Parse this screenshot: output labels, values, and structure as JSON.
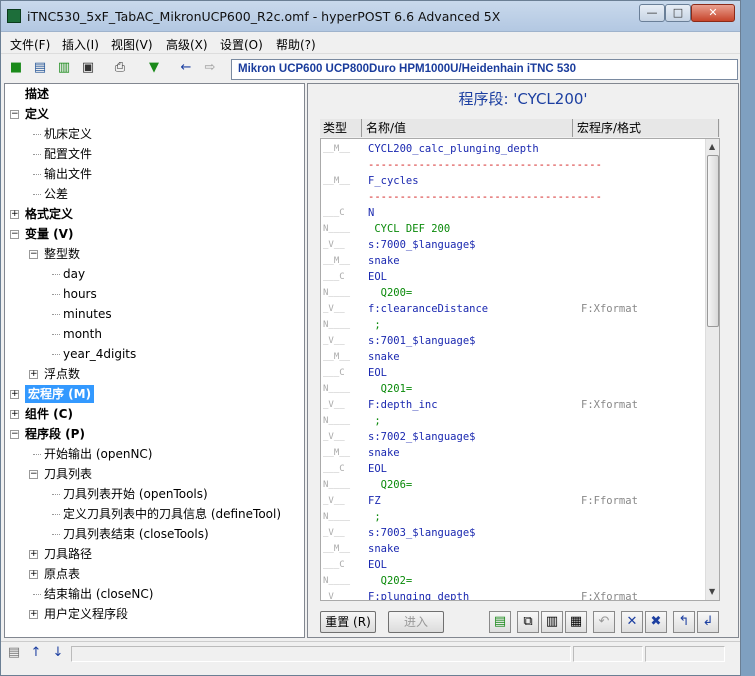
{
  "window": {
    "title": "iTNC530_5xF_TabAC_MikronUCP600_R2c.omf - hyperPOST 6.6 Advanced 5X"
  },
  "menu": [
    "文件(F)",
    "插入(I)",
    "视图(V)",
    "高级(X)",
    "设置(O)",
    "帮助(?)"
  ],
  "toolbar": {
    "postprocessor": "Mikron UCP600 UCP800Duro HPM1000U/Heidenhain iTNC 530"
  },
  "tree": {
    "items": [
      {
        "label": "描述",
        "bold": true,
        "level": 0,
        "toggle": ""
      },
      {
        "label": "定义",
        "bold": true,
        "level": 0,
        "toggle": "-"
      },
      {
        "label": "机床定义",
        "level": 1,
        "toggle": ""
      },
      {
        "label": "配置文件",
        "level": 1,
        "toggle": ""
      },
      {
        "label": "输出文件",
        "level": 1,
        "toggle": ""
      },
      {
        "label": "公差",
        "level": 1,
        "toggle": ""
      },
      {
        "label": "格式定义",
        "bold": true,
        "level": 0,
        "toggle": "+"
      },
      {
        "label": "变量 (V)",
        "bold": true,
        "level": 0,
        "toggle": "-"
      },
      {
        "label": "整型数",
        "level": 1,
        "toggle": "-"
      },
      {
        "label": "day",
        "level": 2,
        "toggle": ""
      },
      {
        "label": "hours",
        "level": 2,
        "toggle": ""
      },
      {
        "label": "minutes",
        "level": 2,
        "toggle": ""
      },
      {
        "label": "month",
        "level": 2,
        "toggle": ""
      },
      {
        "label": "year_4digits",
        "level": 2,
        "toggle": ""
      },
      {
        "label": "浮点数",
        "level": 1,
        "toggle": "+"
      },
      {
        "label": "宏程序 (M)",
        "bold": true,
        "level": 0,
        "toggle": "+",
        "selected": true
      },
      {
        "label": "组件 (C)",
        "bold": true,
        "level": 0,
        "toggle": "+"
      },
      {
        "label": "程序段 (P)",
        "bold": true,
        "level": 0,
        "toggle": "-"
      },
      {
        "label": "开始输出 (openNC)",
        "level": 1,
        "toggle": ""
      },
      {
        "label": "刀具列表",
        "level": 1,
        "toggle": "-"
      },
      {
        "label": "刀具列表开始 (openTools)",
        "level": 2,
        "toggle": ""
      },
      {
        "label": "定义刀具列表中的刀具信息 (defineTool)",
        "level": 2,
        "toggle": ""
      },
      {
        "label": "刀具列表结束 (closeTools)",
        "level": 2,
        "toggle": ""
      },
      {
        "label": "刀具路径",
        "level": 1,
        "toggle": "+"
      },
      {
        "label": "原点表",
        "level": 1,
        "toggle": "+"
      },
      {
        "label": "结束输出 (closeNC)",
        "level": 1,
        "toggle": ""
      },
      {
        "label": "用户定义程序段",
        "level": 1,
        "toggle": "+"
      }
    ]
  },
  "panel": {
    "title": "程序段: 'CYCL200'",
    "headers": {
      "type": "类型",
      "name": "名称/值",
      "format": "宏程序/格式"
    },
    "rows": [
      {
        "t": "__M__",
        "n": "CYCL200_calc_plunging_depth",
        "c": "",
        "f": ""
      },
      {
        "t": "",
        "n": "-------------------------------------",
        "c": "red",
        "f": ""
      },
      {
        "t": "__M__",
        "n": "F_cycles",
        "c": "",
        "f": ""
      },
      {
        "t": "",
        "n": "-------------------------------------",
        "c": "red",
        "f": ""
      },
      {
        "t": "___C",
        "n": "N",
        "c": "",
        "f": ""
      },
      {
        "t": "N____",
        "n": " CYCL DEF 200",
        "c": "grn",
        "f": ""
      },
      {
        "t": "_V__",
        "n": "s:7000_$language$",
        "c": "",
        "f": ""
      },
      {
        "t": "__M__",
        "n": "snake",
        "c": "",
        "f": ""
      },
      {
        "t": "___C",
        "n": "EOL",
        "c": "",
        "f": ""
      },
      {
        "t": "N____",
        "n": "  Q200=",
        "c": "grn",
        "f": ""
      },
      {
        "t": "_V__",
        "n": "f:clearanceDistance",
        "c": "",
        "f": "F:Xformat"
      },
      {
        "t": "N____",
        "n": " ;",
        "c": "grn",
        "f": ""
      },
      {
        "t": "_V__",
        "n": "s:7001_$language$",
        "c": "",
        "f": ""
      },
      {
        "t": "__M__",
        "n": "snake",
        "c": "",
        "f": ""
      },
      {
        "t": "___C",
        "n": "EOL",
        "c": "",
        "f": ""
      },
      {
        "t": "N____",
        "n": "  Q201=",
        "c": "grn",
        "f": ""
      },
      {
        "t": "_V__",
        "n": "F:depth_inc",
        "c": "",
        "f": "F:Xformat"
      },
      {
        "t": "N____",
        "n": " ;",
        "c": "grn",
        "f": ""
      },
      {
        "t": "_V__",
        "n": "s:7002_$language$",
        "c": "",
        "f": ""
      },
      {
        "t": "__M__",
        "n": "snake",
        "c": "",
        "f": ""
      },
      {
        "t": "___C",
        "n": "EOL",
        "c": "",
        "f": ""
      },
      {
        "t": "N____",
        "n": "  Q206=",
        "c": "grn",
        "f": ""
      },
      {
        "t": "_V__",
        "n": "FZ",
        "c": "",
        "f": "F:Fformat"
      },
      {
        "t": "N____",
        "n": " ;",
        "c": "grn",
        "f": ""
      },
      {
        "t": "_V__",
        "n": "s:7003_$language$",
        "c": "",
        "f": ""
      },
      {
        "t": "__M__",
        "n": "snake",
        "c": "",
        "f": ""
      },
      {
        "t": "___C",
        "n": "EOL",
        "c": "",
        "f": ""
      },
      {
        "t": "N____",
        "n": "  Q202=",
        "c": "grn",
        "f": ""
      },
      {
        "t": "_V__",
        "n": "F:plunging_depth",
        "c": "",
        "f": "F:Xformat"
      }
    ],
    "reset_label": "重置 (R)",
    "enter_label": "进入"
  },
  "colors": {
    "accent": "#1c3fa1",
    "select": "#3399ff",
    "macro": "#1a28b0",
    "separator": "#d01010",
    "literal": "#0a8a0a"
  }
}
